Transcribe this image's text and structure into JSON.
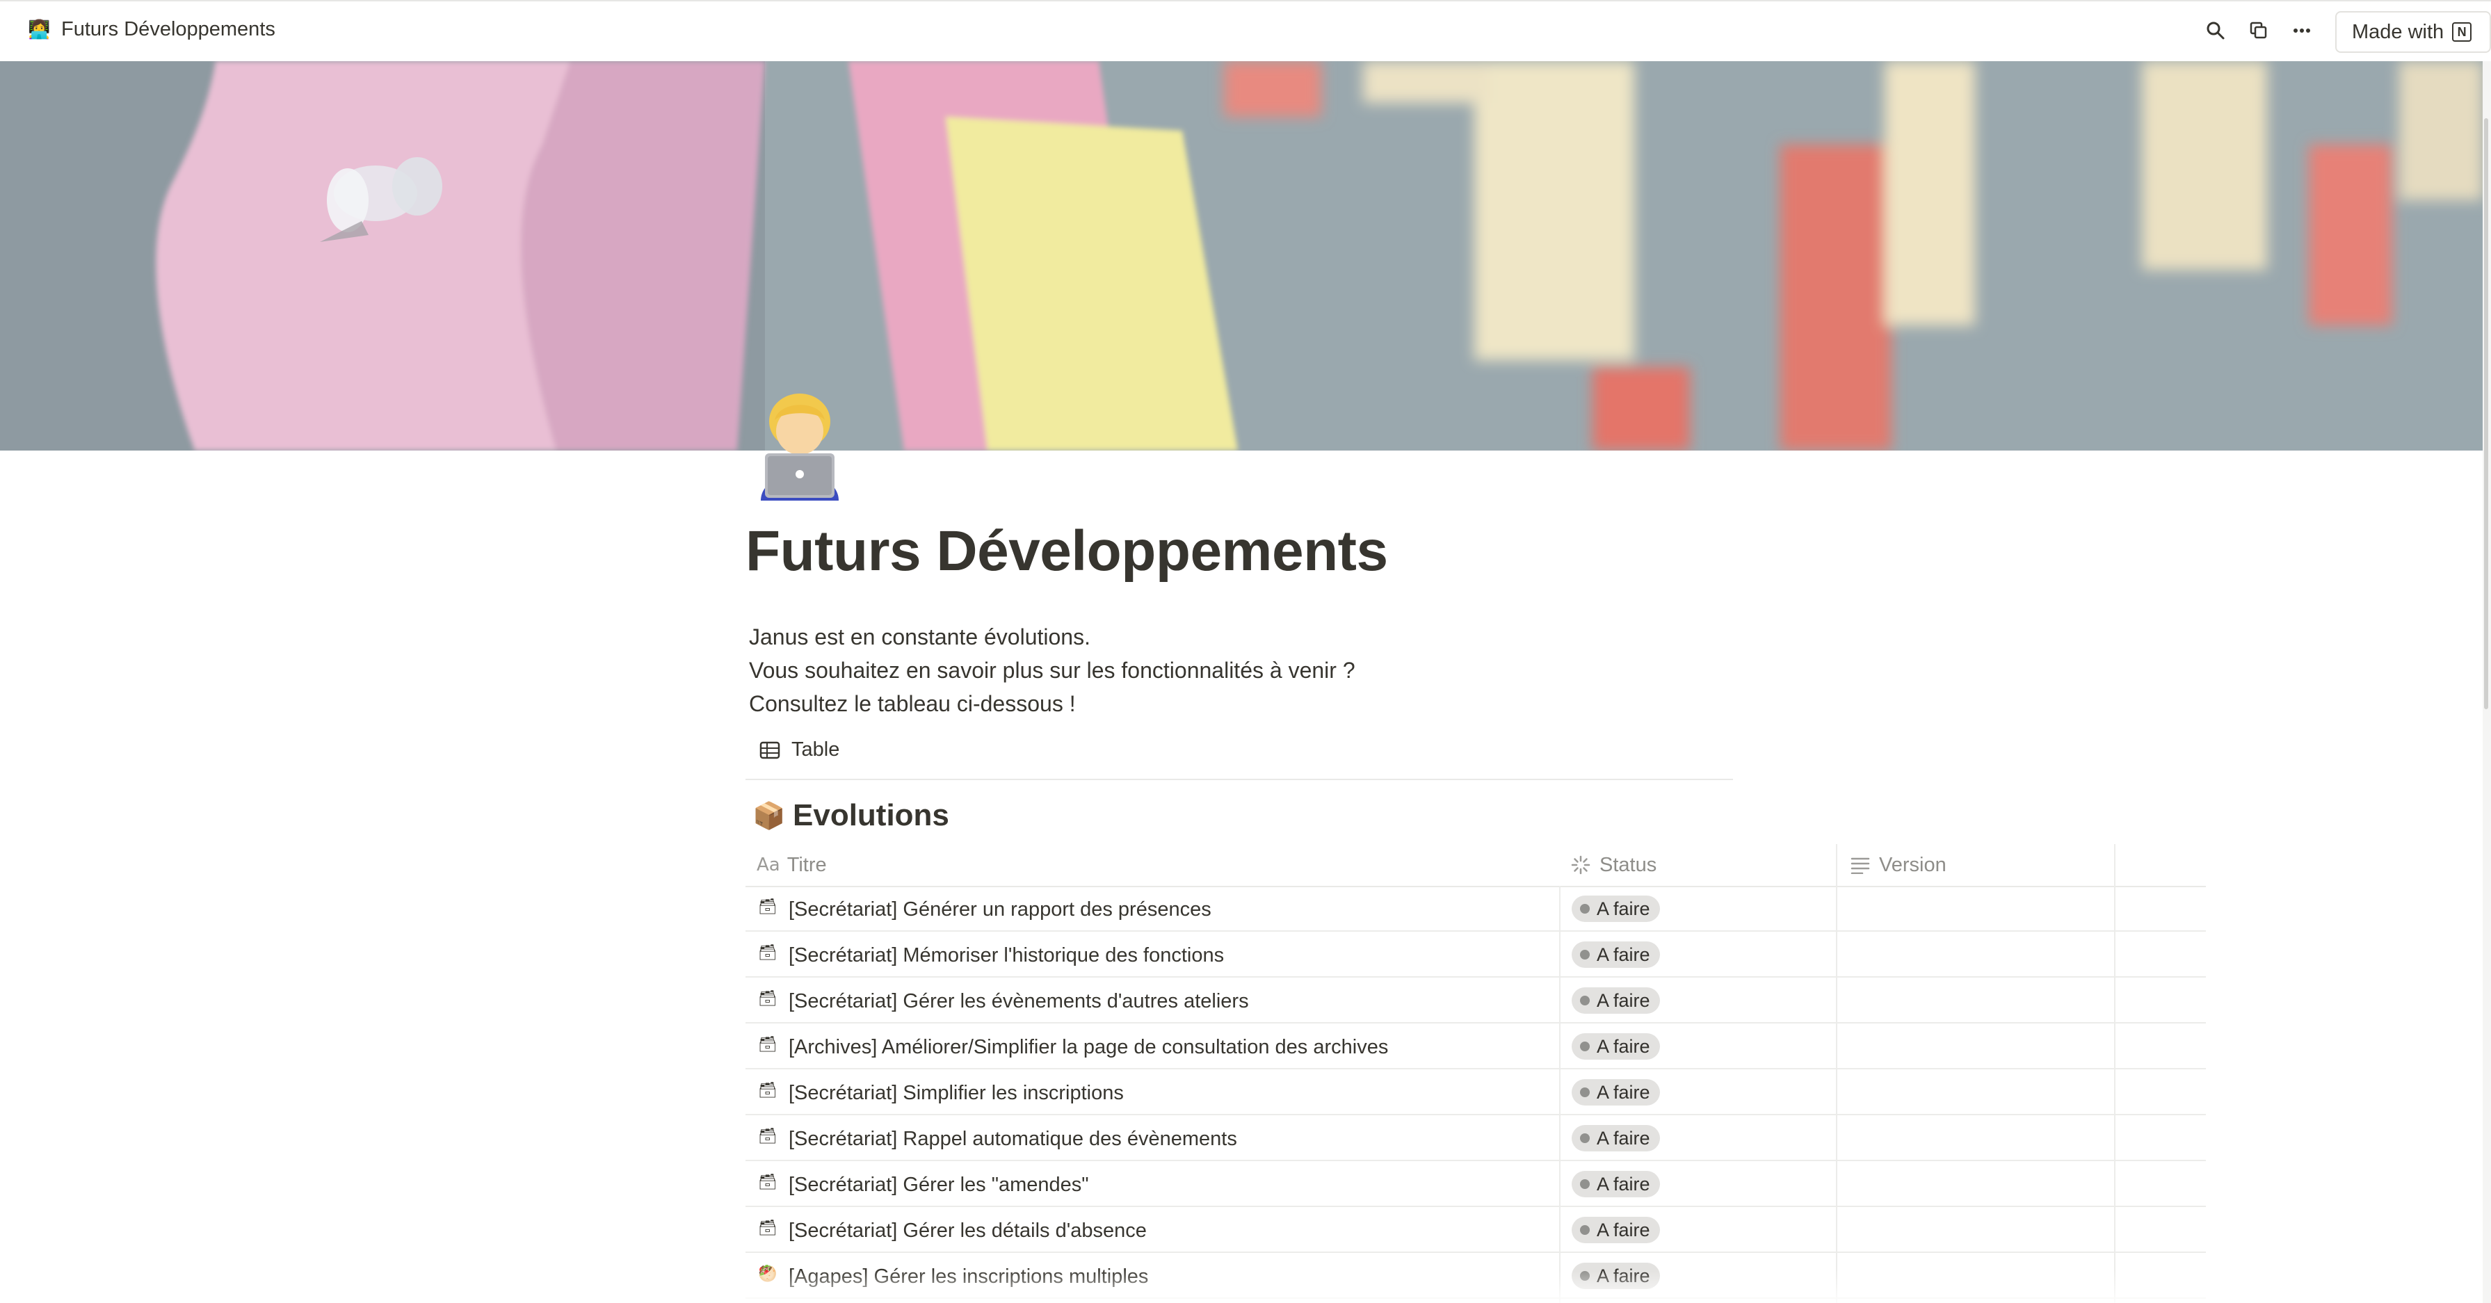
{
  "topbar": {
    "page_emoji": "👩‍💻",
    "breadcrumb_title": "Futurs Développements",
    "icons": [
      "search-icon",
      "duplicate-icon",
      "more-icon"
    ],
    "made_with_label": "Made with",
    "notion_mark": "N"
  },
  "cover": {
    "description_icon": "cover-image"
  },
  "page": {
    "icon_emoji": "🧑‍💻",
    "title": "Futurs Développements",
    "description_lines": [
      "Janus est en constante évolutions.",
      "Vous souhaitez en savoir plus sur les fonctionnalités à venir ?",
      "Consultez le tableau ci-dessous !"
    ]
  },
  "view": {
    "tab_label": "Table",
    "tab_icon": "table-icon"
  },
  "database": {
    "emoji": "📦",
    "title": "Evolutions",
    "columns": [
      {
        "icon": "Aa",
        "label": "Titre"
      },
      {
        "icon": "status-icon",
        "label": "Status"
      },
      {
        "icon": "text-icon",
        "label": "Version"
      }
    ],
    "rows": [
      {
        "emoji": "🗃",
        "title": "[Secrétariat] Générer un rapport des présences",
        "status": "A faire",
        "version": ""
      },
      {
        "emoji": "🗃",
        "title": "[Secrétariat] Mémoriser l'historique des fonctions",
        "status": "A faire",
        "version": ""
      },
      {
        "emoji": "🗃",
        "title": "[Secrétariat] Gérer les évènements d'autres ateliers",
        "status": "A faire",
        "version": ""
      },
      {
        "emoji": "🗃",
        "title": "[Archives] Améliorer/Simplifier la page de consultation des archives",
        "status": "A faire",
        "version": ""
      },
      {
        "emoji": "🗃",
        "title": "[Secrétariat] Simplifier les inscriptions",
        "status": "A faire",
        "version": ""
      },
      {
        "emoji": "🗃",
        "title": "[Secrétariat] Rappel automatique des évènements",
        "status": "A faire",
        "version": ""
      },
      {
        "emoji": "🗃",
        "title": "[Secrétariat] Gérer les \"amendes\"",
        "status": "A faire",
        "version": ""
      },
      {
        "emoji": "🗃",
        "title": "[Secrétariat] Gérer les détails d'absence",
        "status": "A faire",
        "version": ""
      },
      {
        "emoji": "🥙",
        "title": "[Agapes] Gérer les inscriptions multiples",
        "status": "A faire",
        "version": ""
      }
    ]
  },
  "colors": {
    "text": "#37352f",
    "muted": "#8e8d89",
    "pill_bg": "#e3e2e0",
    "pill_dot": "#91918e",
    "border": "#e9e9e7"
  }
}
